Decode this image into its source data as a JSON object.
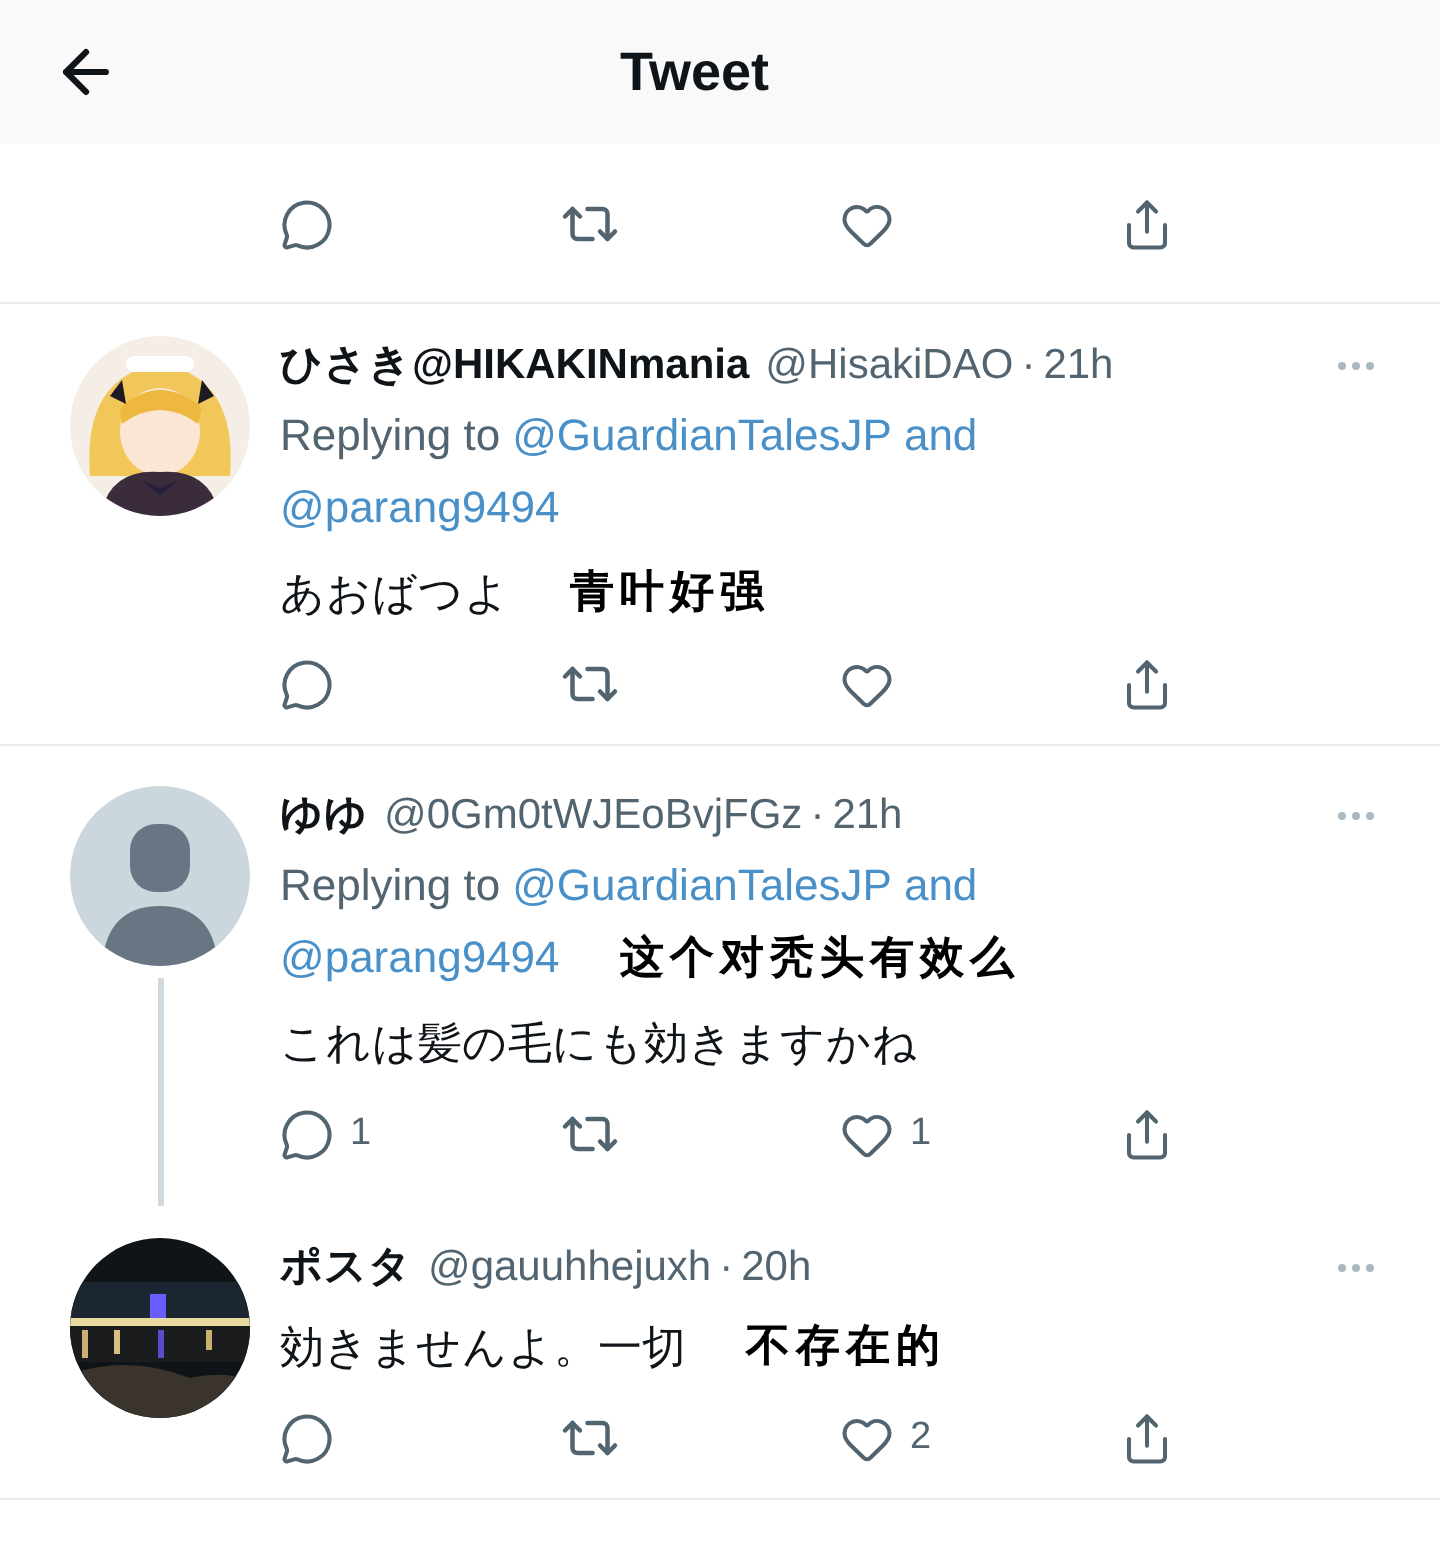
{
  "header": {
    "title": "Tweet"
  },
  "meta_separator": "·",
  "tweets": [
    {
      "name": "ひさき@HIKAKINmania",
      "handle": "@HisakiDAO",
      "time": "21h",
      "avatar": {
        "kind": "picture_anime"
      },
      "thread_line": false,
      "replying": {
        "prefix": "Replying to",
        "links": [
          "@GuardianTalesJP",
          "@parang9494"
        ],
        "joiner": "and"
      },
      "text": "あおばつよ",
      "annotation": "青叶好强"
    },
    {
      "name": "ゆゆ",
      "handle": "@0Gm0tWJEoBvjFGz",
      "time": "21h",
      "avatar": {
        "kind": "default"
      },
      "thread_line": true,
      "replying": {
        "prefix": "Replying to",
        "links": [
          "@GuardianTalesJP",
          "@parang9494"
        ],
        "joiner": "and",
        "annotation": "这个对秃头有效么"
      },
      "text": "これは髪の毛にも効きますかね",
      "counts": {
        "reply": "1",
        "like": "1"
      }
    },
    {
      "name": "ポスタ",
      "handle": "@gauuhhejuxh",
      "time": "20h",
      "avatar": {
        "kind": "picture_night"
      },
      "thread_line": false,
      "text": "効きませんよ。一切",
      "annotation": "不存在的",
      "counts": {
        "like": "2"
      }
    }
  ]
}
